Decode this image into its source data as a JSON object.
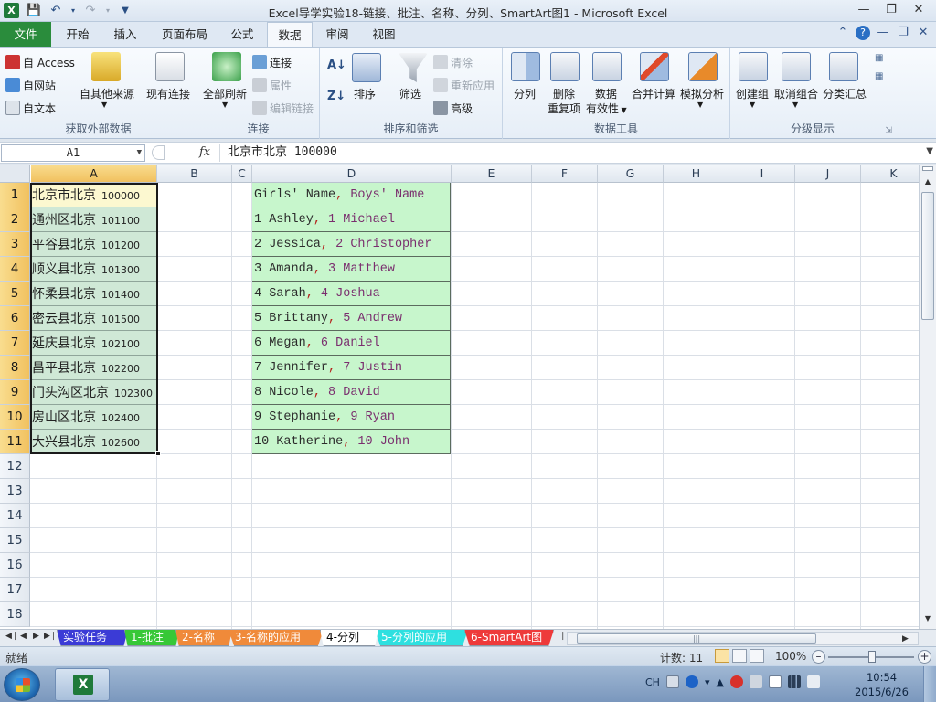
{
  "window": {
    "title": "Excel导学实验18-链接、批注、名称、分列、SmartArt图1 - Microsoft Excel",
    "app_icon": "excel-icon",
    "controls": [
      "minimize",
      "restore",
      "close"
    ]
  },
  "ribbon": {
    "tabs": [
      "文件",
      "开始",
      "插入",
      "页面布局",
      "公式",
      "数据",
      "审阅",
      "视图"
    ],
    "active_tab": "数据",
    "groups": {
      "external": {
        "label": "获取外部数据",
        "from_access": "自 Access",
        "from_web": "自网站",
        "from_text": "自文本",
        "other_sources": "自其他来源",
        "existing": "现有连接"
      },
      "connections": {
        "label": "连接",
        "refresh_all": "全部刷新",
        "connections": "连接",
        "properties": "属性",
        "edit_links": "编辑链接"
      },
      "sort_filter": {
        "label": "排序和筛选",
        "sort": "排序",
        "filter": "筛选",
        "clear": "清除",
        "reapply": "重新应用",
        "advanced": "高级"
      },
      "data_tools": {
        "label": "数据工具",
        "text_to_columns": "分列",
        "remove_dup_1": "删除",
        "remove_dup_2": "重复项",
        "validation_1": "数据",
        "validation_2": "有效性",
        "consolidate": "合并计算",
        "what_if": "模拟分析"
      },
      "outline": {
        "label": "分级显示",
        "group": "创建组",
        "ungroup": "取消组合",
        "subtotal": "分类汇总"
      }
    }
  },
  "formula_bar": {
    "name_box": "A1",
    "fx": "fx",
    "content": "北京市北京 100000"
  },
  "grid": {
    "columns": [
      "A",
      "B",
      "C",
      "D",
      "E",
      "F",
      "G",
      "H",
      "I",
      "J",
      "K"
    ],
    "rows": [
      "1",
      "2",
      "3",
      "4",
      "5",
      "6",
      "7",
      "8",
      "9",
      "10",
      "11",
      "12",
      "13",
      "14",
      "15",
      "16",
      "17",
      "18"
    ],
    "column_a": [
      {
        "place": "北京市北京",
        "code": "100000"
      },
      {
        "place": "通州区北京",
        "code": "101100"
      },
      {
        "place": "平谷县北京",
        "code": "101200"
      },
      {
        "place": "顺义县北京",
        "code": "101300"
      },
      {
        "place": "怀柔县北京",
        "code": "101400"
      },
      {
        "place": "密云县北京",
        "code": "101500"
      },
      {
        "place": "延庆县北京",
        "code": "102100"
      },
      {
        "place": "昌平县北京",
        "code": "102200"
      },
      {
        "place": "门头沟区北京",
        "code": "102300"
      },
      {
        "place": "房山区北京",
        "code": "102400"
      },
      {
        "place": "大兴县北京",
        "code": "102600"
      }
    ],
    "column_d": [
      {
        "girl": "Girls' Name",
        "sep": ",",
        "boy": " Boys' Name"
      },
      {
        "girl": "1 Ashley",
        "sep": ",",
        "boy": " 1 Michael"
      },
      {
        "girl": "2 Jessica",
        "sep": ",",
        "boy": " 2 Christopher"
      },
      {
        "girl": "3 Amanda",
        "sep": ",",
        "boy": " 3 Matthew"
      },
      {
        "girl": "4 Sarah",
        "sep": ",",
        "boy": " 4 Joshua"
      },
      {
        "girl": "5 Brittany",
        "sep": ",",
        "boy": " 5 Andrew"
      },
      {
        "girl": "6 Megan",
        "sep": ",",
        "boy": " 6 Daniel"
      },
      {
        "girl": "7 Jennifer",
        "sep": ",",
        "boy": " 7 Justin"
      },
      {
        "girl": "8 Nicole",
        "sep": ",",
        "boy": " 8 David"
      },
      {
        "girl": "9 Stephanie",
        "sep": ",",
        "boy": " 9 Ryan"
      },
      {
        "girl": "10 Katherine",
        "sep": ",",
        "boy": " 10 John"
      }
    ]
  },
  "sheet_tabs": [
    {
      "label": "实验任务",
      "color": "#3b3bd6"
    },
    {
      "label": "1-批注",
      "color": "#37c837"
    },
    {
      "label": "2-名称",
      "color": "#f08a3a"
    },
    {
      "label": "3-名称的应用",
      "color": "#f08a3a"
    },
    {
      "label": "4-分列",
      "color": "#ffffff"
    },
    {
      "label": "5-分列的应用",
      "color": "#2ee0e0"
    },
    {
      "label": "6-SmartArt图",
      "color": "#ee3a3a"
    }
  ],
  "active_sheet": "4-分列",
  "status": {
    "ready": "就绪",
    "count": "计数: 11",
    "zoom": "100%"
  },
  "taskbar": {
    "lang": "CH",
    "time": "10:54",
    "date": "2015/6/26"
  }
}
